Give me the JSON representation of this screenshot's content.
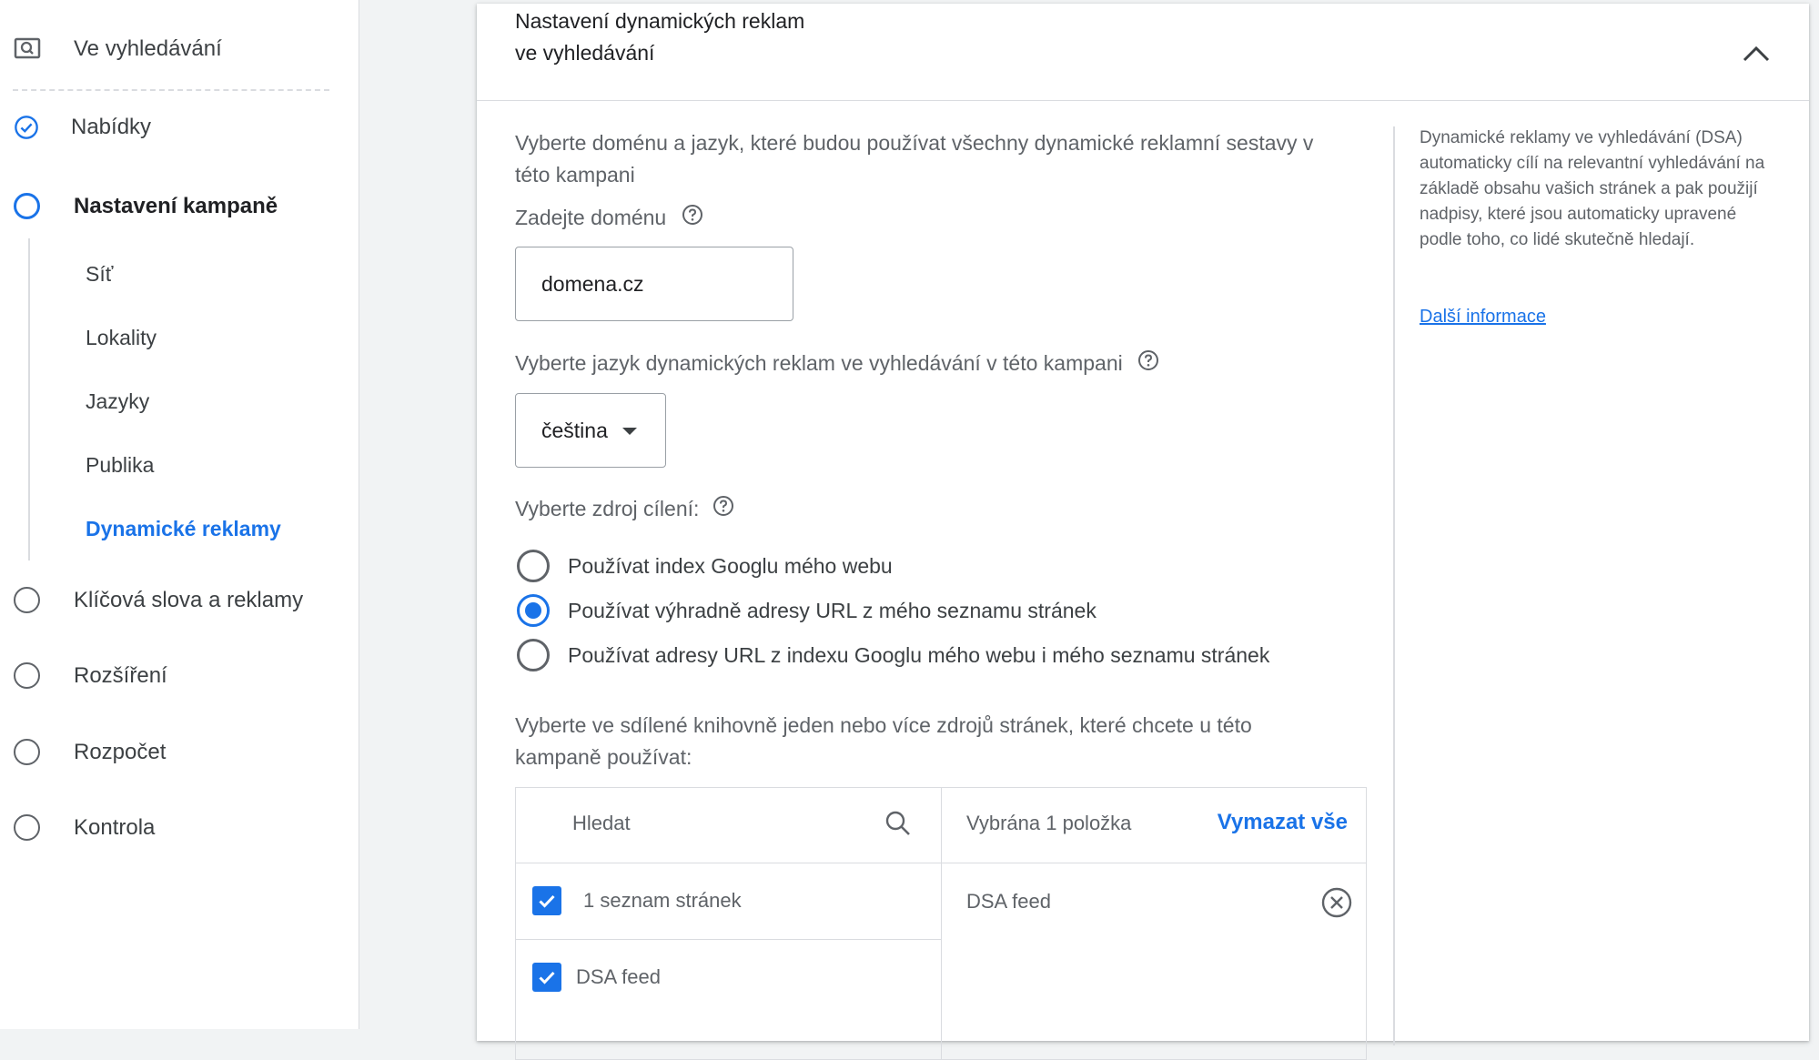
{
  "sidebar": {
    "top_item": "Ve vyhledávání",
    "steps": [
      {
        "label": "Nabídky"
      },
      {
        "label": "Nastavení kampaně"
      },
      {
        "label": "Klíčová slova a reklamy"
      },
      {
        "label": "Rozšíření"
      },
      {
        "label": "Rozpočet"
      },
      {
        "label": "Kontrola"
      }
    ],
    "substeps": [
      "Síť",
      "Lokality",
      "Jazyky",
      "Publika",
      "Dynamické reklamy"
    ]
  },
  "card": {
    "title": "Nastavení dynamických reklam ve vyhledávání",
    "intro": "Vyberte doménu a jazyk, které budou používat všechny dynamické reklamní sestavy v této kampani",
    "domain_label": "Zadejte doménu",
    "domain_value": "domena.cz",
    "language_label": "Vyberte jazyk dynamických reklam ve vyhledávání v této kampani",
    "language_value": "čeština",
    "targeting_label": "Vyberte zdroj cílení:",
    "radio_options": [
      "Používat index Googlu mého webu",
      "Používat výhradně adresy URL z mého seznamu stránek",
      "Používat adresy URL z indexu Googlu mého webu i mého seznamu stránek"
    ],
    "feeds_label": "Vyberte ve sdílené knihovně jeden nebo více zdrojů stránek, které chcete u této kampaně používat:",
    "picker": {
      "search_placeholder": "Hledat",
      "items": [
        "1 seznam stránek",
        "DSA feed"
      ],
      "selected_count": "Vybrána 1 položka",
      "clear_all": "Vymazat vše",
      "selected": [
        "DSA feed"
      ]
    }
  },
  "help": {
    "text": "Dynamické reklamy ve vyhledávání (DSA) automaticky cílí na relevantní vyhledávání na základě obsahu vašich stránek a pak použijí nadpisy, které jsou automaticky upravené podle toho, co lidé skutečně hledají.",
    "link": "Další informace"
  },
  "colors": {
    "accent": "#1a73e8",
    "text": "#3c4043",
    "muted": "#5f6368",
    "border": "#dadce0"
  }
}
